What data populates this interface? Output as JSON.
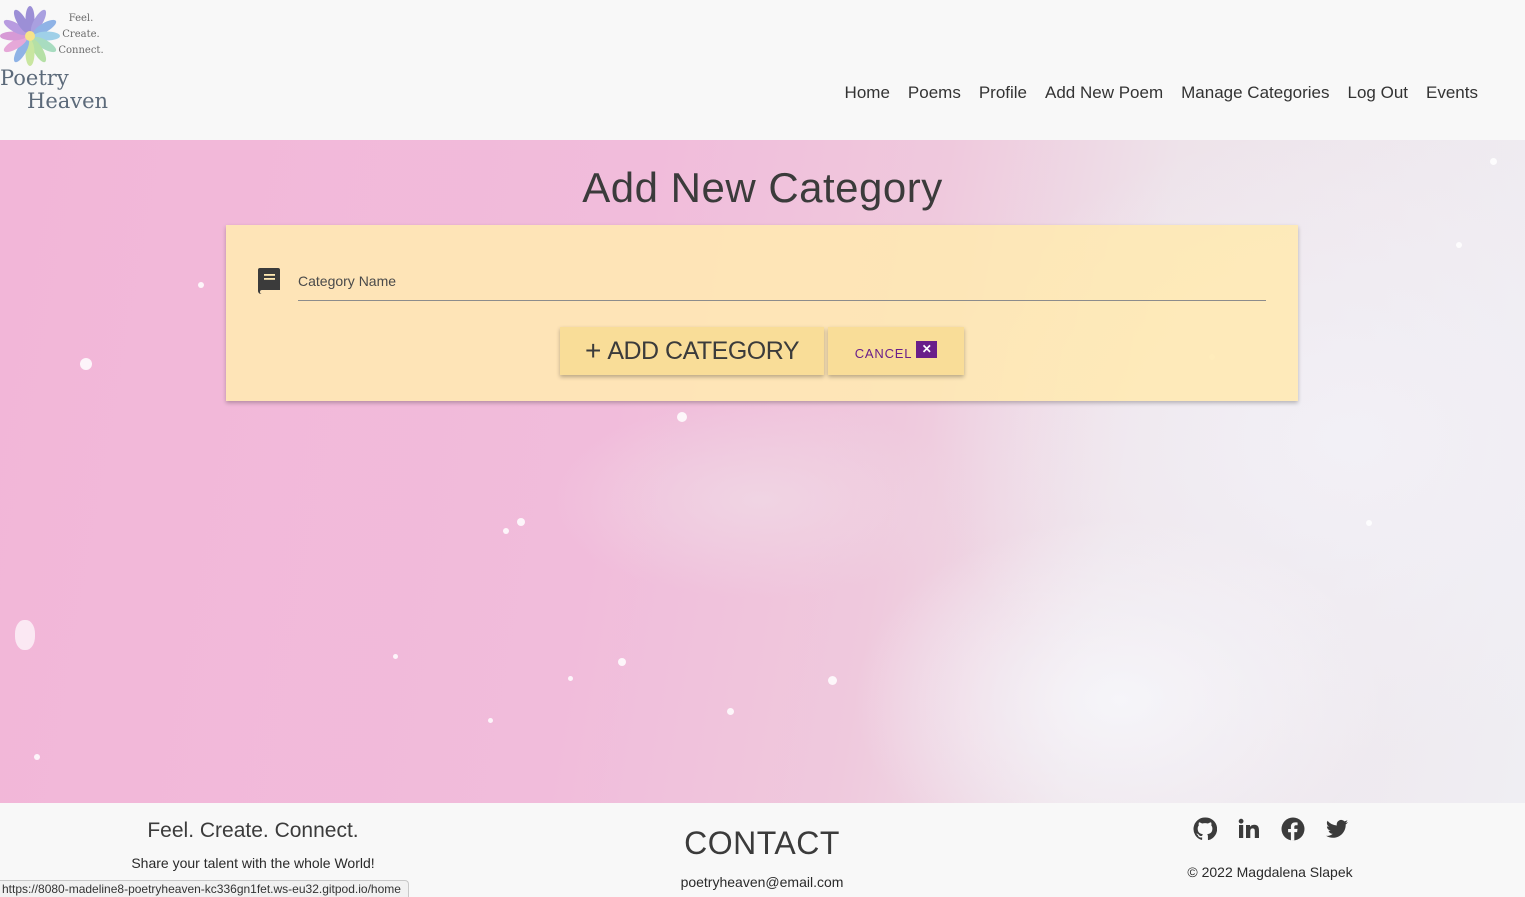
{
  "header": {
    "logo": {
      "taglines": [
        "Feel.",
        "Create.",
        "Connect."
      ],
      "name_line1": "Poetry",
      "name_line2": "Heaven"
    },
    "nav": [
      {
        "label": "Home"
      },
      {
        "label": "Poems"
      },
      {
        "label": "Profile"
      },
      {
        "label": "Add New Poem"
      },
      {
        "label": "Manage Categories"
      },
      {
        "label": "Log Out"
      },
      {
        "label": "Events"
      }
    ]
  },
  "main": {
    "title": "Add New Category",
    "form": {
      "field_label": "Category Name",
      "field_value": "",
      "add_button": {
        "icon": "plus-icon",
        "label": "ADD CATEGORY"
      },
      "cancel_button": {
        "label": "CANCEL",
        "icon": "close-icon"
      }
    }
  },
  "footer": {
    "slogan": "Feel. Create. Connect.",
    "share_text": "Share your talent with the whole World!",
    "contact_heading": "CONTACT",
    "email": "poetryheaven@email.com",
    "socials": [
      {
        "icon": "github-icon"
      },
      {
        "icon": "linkedin-icon"
      },
      {
        "icon": "facebook-icon"
      },
      {
        "icon": "twitter-icon"
      }
    ],
    "copyright": "© 2022 Magdalena Slapek"
  },
  "status_url": "https://8080-madeline8-poetryheaven-kc336gn1fet.ws-eu32.gitpod.io/home",
  "colors": {
    "card_bg": "#ffe9b2",
    "button_bg": "#f9dd98",
    "cancel_accent": "#6a1e8a",
    "hero_pink": "#f2b6d8"
  }
}
